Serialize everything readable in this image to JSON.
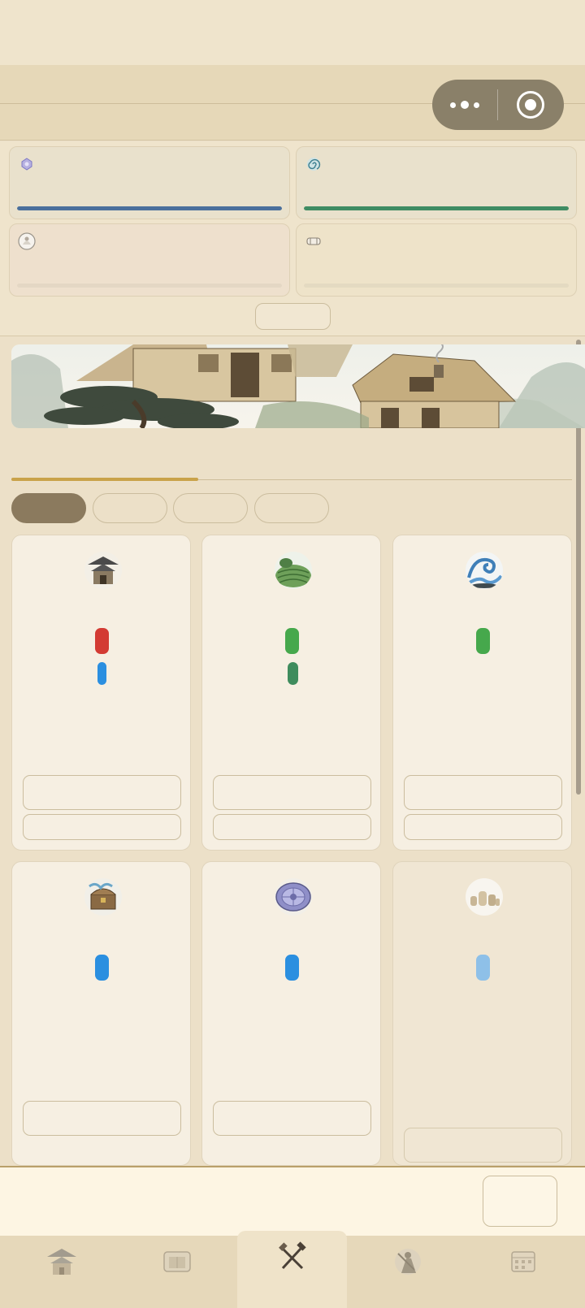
{
  "capsule": {
    "more_icon": "more-dots-icon",
    "close_icon": "target-circle-icon"
  },
  "stats": [
    {
      "icon": "crystal-icon",
      "color": "#4a6f9c",
      "fill": 1.0,
      "bg": "#e9e1cc"
    },
    {
      "icon": "swirl-icon",
      "color": "#3f8c63",
      "fill": 1.0,
      "bg": "#e9e1cc"
    },
    {
      "icon": "scroll-portrait-icon",
      "color": "#d6c7ad",
      "fill": 0.0,
      "bg": "#eee0cd"
    },
    {
      "icon": "silk-roll-icon",
      "color": "#d6c7ad",
      "fill": 0.0,
      "bg": "#eee3c9"
    }
  ],
  "filter_tabs": [
    {
      "active": true
    },
    {
      "active": false
    },
    {
      "active": false
    },
    {
      "active": false
    }
  ],
  "cards": [
    {
      "icon": "pavilion-icon",
      "pills": [
        "#d33b33",
        "#2b8fe0"
      ],
      "buttons": 2
    },
    {
      "icon": "terraced-field-icon",
      "pills": [
        "#46a84c",
        "#3f8c5d"
      ],
      "buttons": 2
    },
    {
      "icon": "wave-icon",
      "pills": [
        "#46a84c"
      ],
      "buttons": 2
    },
    {
      "icon": "treasure-chest-icon",
      "pills": [
        "#2b8fe0"
      ],
      "buttons": 1
    },
    {
      "icon": "compass-disc-icon",
      "pills": [
        "#2b8fe0"
      ],
      "buttons": 1
    },
    {
      "icon": "pottery-jars-icon",
      "pills": [
        "#8ec0e8"
      ],
      "buttons": 1,
      "dim": true
    }
  ],
  "tab_bar": [
    {
      "icon": "palace-icon"
    },
    {
      "icon": "scroll-gate-icon"
    },
    {
      "icon": "tools-icon",
      "active": true
    },
    {
      "icon": "warrior-icon"
    },
    {
      "icon": "calendar-scroll-icon"
    }
  ],
  "colors": {
    "accent_gold": "#c9a24a",
    "active_tab": "#8b7a5e",
    "bottom_border": "#b9a06a"
  }
}
